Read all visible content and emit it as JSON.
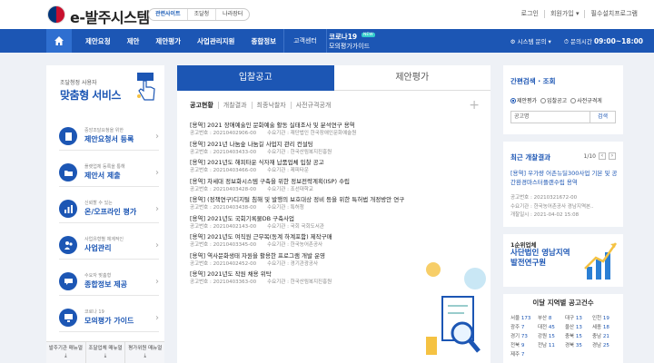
{
  "header": {
    "logo_text": "e-발주시스템",
    "site_links": [
      "관련사이트",
      "조달청",
      "나라장터"
    ],
    "util_links": [
      "로그인",
      "회원가입",
      "필수설치프로그램"
    ]
  },
  "nav": {
    "menu": [
      "제안요청",
      "제안",
      "제안평가",
      "사업관리지원",
      "종합정보"
    ],
    "center_label": "고객센터",
    "corona_line1": "코로나19",
    "corona_line2": "모의평가가이드",
    "new_badge": "NEW",
    "system_inquiry": "시스템 문의",
    "hours_label": "문의시간",
    "hours": "09:00~18:00"
  },
  "left": {
    "small": "조달청정 사용자",
    "big": "맞춤형 서비스",
    "services": [
      {
        "sub": "중앙조달요청을 위한",
        "title": "제안요청서 등록",
        "icon": "document-icon"
      },
      {
        "sub": "플랫업체 등록을 통해",
        "title": "제안서 제출",
        "icon": "folder-icon"
      },
      {
        "sub": "신뢰할 수 있는",
        "title": "온/오프라인 평가",
        "icon": "chart-icon"
      },
      {
        "sub": "사업유형별 체계적인",
        "title": "사업관리",
        "icon": "people-icon"
      },
      {
        "sub": "수요자 맞춤형",
        "title": "종합정보 제공",
        "icon": "chat-icon"
      },
      {
        "sub": "코로나 19",
        "title": "모의평가 가이드",
        "icon": "monitor-icon"
      }
    ],
    "manuals": [
      "발주기관 매뉴얼",
      "조달업체 매뉴얼",
      "평가위원 매뉴얼"
    ]
  },
  "center": {
    "tabs": [
      "입찰공고",
      "제안평가"
    ],
    "subtabs": [
      "공고현황",
      "개찰결과",
      "최종낙찰자",
      "사전규격공개"
    ],
    "items": [
      {
        "title": "[용역] 2021 장애예술인 문화예술 활동 실태조사 및 분석연구 용역",
        "no": "공고번호 : 20210402906-00",
        "org": "수요기관 : 재단법인 한국장애인문화예술원"
      },
      {
        "title": "[용역] 2021년 나눔숲 나눔길 사업지 관리 컨설팅",
        "no": "공고번호 : 20210403433-00",
        "org": "수요기관 : 한국산림복지진흥원"
      },
      {
        "title": "[용역] 2021년도 해피타운 식자재 납품업체 입찰 공고",
        "no": "공고번호 : 20210403466-00",
        "org": "수요기관 : 제피타운"
      },
      {
        "title": "[용역] 차세대 정보화시스템 구축을 위한 정보전략계획(ISP) 수립",
        "no": "공고번호 : 20210403428-00",
        "org": "수요기관 : 조선대학교"
      },
      {
        "title": "[용역] (정책연구)디지털 침해 및 발행의 보호대상 정비 등을 위한 특허법 개정방안 연구",
        "no": "공고번호 : 20210403438-00",
        "org": "수요기관 : 특허청"
      },
      {
        "title": "[용역] 2021년도 국회기록물DB 구축사업",
        "no": "공고번호 : 20210402143-00",
        "org": "수요기관 : 국회 국회도서관"
      },
      {
        "title": "[용역] 2021년도 여직원 근무복(동계 하계포함) 제작구매",
        "no": "공고번호 : 20210403345-00",
        "org": "수요기관 : 한국농어촌공사"
      },
      {
        "title": "[용역] 역사문화생태 자원을 활용한 프로그램 개발 운영",
        "no": "공고번호 : 20210402452-00",
        "org": "수요기관 : 경기관광공사"
      },
      {
        "title": "[용역] 2021년도 작원 채용 위탁",
        "no": "공고번호 : 20210403363-00",
        "org": "수요기관 : 한국산림복지진흥원"
      }
    ]
  },
  "right": {
    "search_title": "간편검색 · 조회",
    "radios": [
      "제안평가",
      "입찰공고",
      "사전규격게"
    ],
    "search_field": "공고명",
    "search_button": "검색",
    "recent_title": "최근 개찰결과",
    "pager": "1/10",
    "recent_item": "[용역] 우가량 어촌뉴딜300사업 기본 및 공간환경마스터플랜수립 용역",
    "recent_meta": [
      "공고번호 : 20210321672-00",
      "수요기관 : 한국농어촌공사 경남지역본..",
      "개찰일시 : 2021-04-02 15:08"
    ],
    "banner_line1": "1순위업체",
    "banner_line2": "사단법인 영남지역 발전연구원",
    "region_title": "이달 지역별 공고건수",
    "regions": [
      {
        "name": "서울",
        "count": "173"
      },
      {
        "name": "부산",
        "count": "8"
      },
      {
        "name": "대구",
        "count": "13"
      },
      {
        "name": "인천",
        "count": "19"
      },
      {
        "name": "광주",
        "count": "7"
      },
      {
        "name": "대전",
        "count": "45"
      },
      {
        "name": "울산",
        "count": "13"
      },
      {
        "name": "세종",
        "count": "18"
      },
      {
        "name": "경기",
        "count": "73"
      },
      {
        "name": "강원",
        "count": "15"
      },
      {
        "name": "충북",
        "count": "15"
      },
      {
        "name": "충남",
        "count": "21"
      },
      {
        "name": "전북",
        "count": "9"
      },
      {
        "name": "전남",
        "count": "11"
      },
      {
        "name": "경북",
        "count": "35"
      },
      {
        "name": "경남",
        "count": "25"
      },
      {
        "name": "제주",
        "count": "7"
      }
    ]
  }
}
